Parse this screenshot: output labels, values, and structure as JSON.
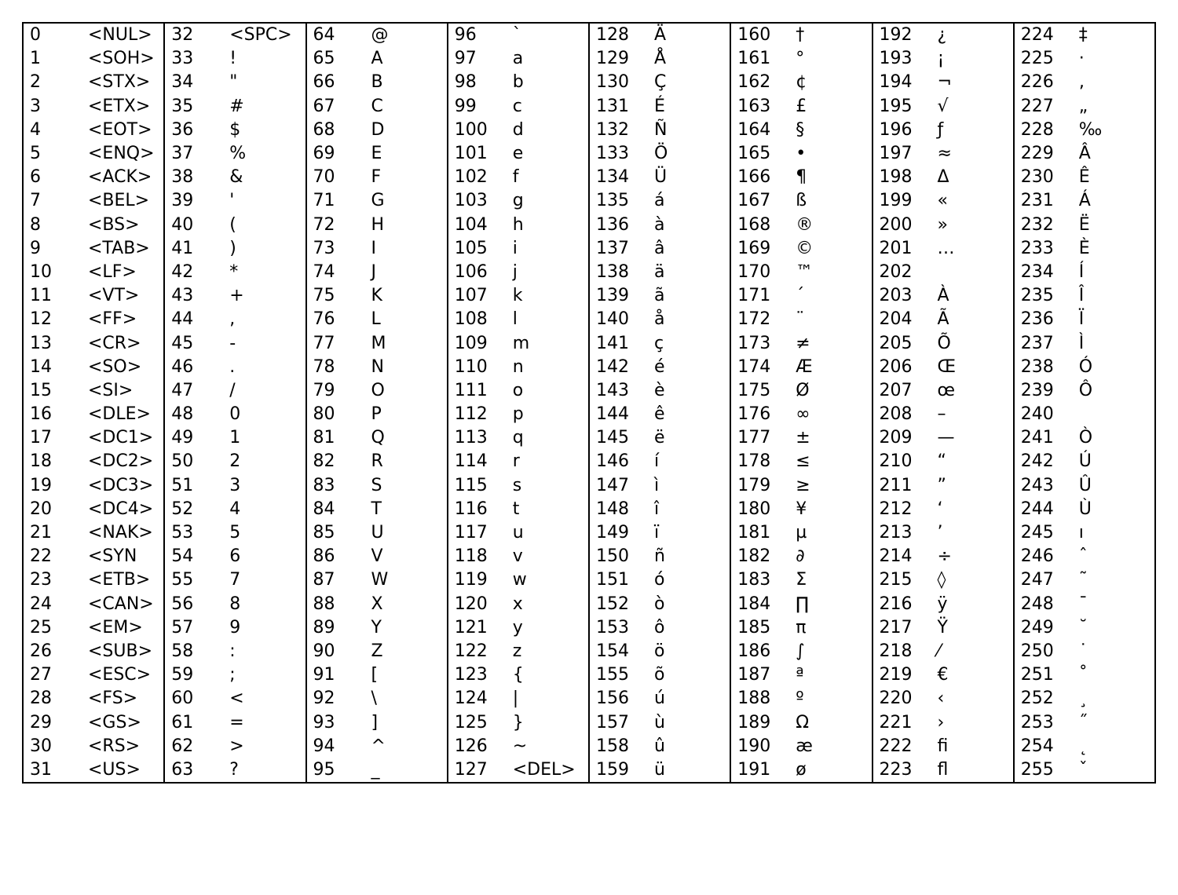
{
  "columns": [
    [
      {
        "code": "0",
        "char": "<NUL>"
      },
      {
        "code": "1",
        "char": "<SOH>"
      },
      {
        "code": "2",
        "char": "<STX>"
      },
      {
        "code": "3",
        "char": "<ETX>"
      },
      {
        "code": "4",
        "char": "<EOT>"
      },
      {
        "code": "5",
        "char": "<ENQ>"
      },
      {
        "code": "6",
        "char": "<ACK>"
      },
      {
        "code": "7",
        "char": "<BEL>"
      },
      {
        "code": "8",
        "char": "<BS>"
      },
      {
        "code": "9",
        "char": "<TAB>"
      },
      {
        "code": "10",
        "char": "<LF>"
      },
      {
        "code": "11",
        "char": "<VT>"
      },
      {
        "code": "12",
        "char": "<FF>"
      },
      {
        "code": "13",
        "char": "<CR>"
      },
      {
        "code": "14",
        "char": "<SO>"
      },
      {
        "code": "15",
        "char": "<SI>"
      },
      {
        "code": "16",
        "char": "<DLE>"
      },
      {
        "code": "17",
        "char": "<DC1>"
      },
      {
        "code": "18",
        "char": "<DC2>"
      },
      {
        "code": "19",
        "char": "<DC3>"
      },
      {
        "code": "20",
        "char": "<DC4>"
      },
      {
        "code": "21",
        "char": "<NAK>"
      },
      {
        "code": "22",
        "char": "<SYN"
      },
      {
        "code": "23",
        "char": "<ETB>"
      },
      {
        "code": "24",
        "char": "<CAN>"
      },
      {
        "code": "25",
        "char": "<EM>"
      },
      {
        "code": "26",
        "char": "<SUB>"
      },
      {
        "code": "27",
        "char": "<ESC>"
      },
      {
        "code": "28",
        "char": "<FS>"
      },
      {
        "code": "29",
        "char": "<GS>"
      },
      {
        "code": "30",
        "char": "<RS>"
      },
      {
        "code": "31",
        "char": "<US>"
      }
    ],
    [
      {
        "code": "32",
        "char": "<SPC>"
      },
      {
        "code": "33",
        "char": "!"
      },
      {
        "code": "34",
        "char": "\""
      },
      {
        "code": "35",
        "char": "#"
      },
      {
        "code": "36",
        "char": "$"
      },
      {
        "code": "37",
        "char": "%"
      },
      {
        "code": "38",
        "char": "&"
      },
      {
        "code": "39",
        "char": "'"
      },
      {
        "code": "40",
        "char": "("
      },
      {
        "code": "41",
        "char": ")"
      },
      {
        "code": "42",
        "char": "*"
      },
      {
        "code": "43",
        "char": "+"
      },
      {
        "code": "44",
        "char": ","
      },
      {
        "code": "45",
        "char": "-"
      },
      {
        "code": "46",
        "char": "."
      },
      {
        "code": "47",
        "char": "/"
      },
      {
        "code": "48",
        "char": "0"
      },
      {
        "code": "49",
        "char": "1"
      },
      {
        "code": "50",
        "char": "2"
      },
      {
        "code": "51",
        "char": "3"
      },
      {
        "code": "52",
        "char": "4"
      },
      {
        "code": "53",
        "char": "5"
      },
      {
        "code": "54",
        "char": "6"
      },
      {
        "code": "55",
        "char": "7"
      },
      {
        "code": "56",
        "char": "8"
      },
      {
        "code": "57",
        "char": "9"
      },
      {
        "code": "58",
        "char": ":"
      },
      {
        "code": "59",
        "char": ";"
      },
      {
        "code": "60",
        "char": "<"
      },
      {
        "code": "61",
        "char": "="
      },
      {
        "code": "62",
        "char": ">"
      },
      {
        "code": "63",
        "char": "?"
      }
    ],
    [
      {
        "code": "64",
        "char": "@"
      },
      {
        "code": "65",
        "char": "A"
      },
      {
        "code": "66",
        "char": "B"
      },
      {
        "code": "67",
        "char": "C"
      },
      {
        "code": "68",
        "char": "D"
      },
      {
        "code": "69",
        "char": "E"
      },
      {
        "code": "70",
        "char": "F"
      },
      {
        "code": "71",
        "char": "G"
      },
      {
        "code": "72",
        "char": "H"
      },
      {
        "code": "73",
        "char": "I"
      },
      {
        "code": "74",
        "char": "J"
      },
      {
        "code": "75",
        "char": "K"
      },
      {
        "code": "76",
        "char": "L"
      },
      {
        "code": "77",
        "char": "M"
      },
      {
        "code": "78",
        "char": "N"
      },
      {
        "code": "79",
        "char": "O"
      },
      {
        "code": "80",
        "char": "P"
      },
      {
        "code": "81",
        "char": "Q"
      },
      {
        "code": "82",
        "char": "R"
      },
      {
        "code": "83",
        "char": "S"
      },
      {
        "code": "84",
        "char": "T"
      },
      {
        "code": "85",
        "char": "U"
      },
      {
        "code": "86",
        "char": "V"
      },
      {
        "code": "87",
        "char": "W"
      },
      {
        "code": "88",
        "char": "X"
      },
      {
        "code": "89",
        "char": "Y"
      },
      {
        "code": "90",
        "char": "Z"
      },
      {
        "code": "91",
        "char": "["
      },
      {
        "code": "92",
        "char": "\\"
      },
      {
        "code": "93",
        "char": "]"
      },
      {
        "code": "94",
        "char": "^"
      },
      {
        "code": "95",
        "char": "_"
      }
    ],
    [
      {
        "code": "96",
        "char": "`"
      },
      {
        "code": "97",
        "char": "a"
      },
      {
        "code": "98",
        "char": "b"
      },
      {
        "code": "99",
        "char": "c"
      },
      {
        "code": "100",
        "char": "d"
      },
      {
        "code": "101",
        "char": "e"
      },
      {
        "code": "102",
        "char": "f"
      },
      {
        "code": "103",
        "char": "g"
      },
      {
        "code": "104",
        "char": "h"
      },
      {
        "code": "105",
        "char": "i"
      },
      {
        "code": "106",
        "char": "j"
      },
      {
        "code": "107",
        "char": "k"
      },
      {
        "code": "108",
        "char": "l"
      },
      {
        "code": "109",
        "char": "m"
      },
      {
        "code": "110",
        "char": "n"
      },
      {
        "code": "111",
        "char": "o"
      },
      {
        "code": "112",
        "char": "p"
      },
      {
        "code": "113",
        "char": "q"
      },
      {
        "code": "114",
        "char": "r"
      },
      {
        "code": "115",
        "char": "s"
      },
      {
        "code": "116",
        "char": "t"
      },
      {
        "code": "117",
        "char": "u"
      },
      {
        "code": "118",
        "char": "v"
      },
      {
        "code": "119",
        "char": "w"
      },
      {
        "code": "120",
        "char": "x"
      },
      {
        "code": "121",
        "char": "y"
      },
      {
        "code": "122",
        "char": "z"
      },
      {
        "code": "123",
        "char": "{"
      },
      {
        "code": "124",
        "char": "|"
      },
      {
        "code": "125",
        "char": "}"
      },
      {
        "code": "126",
        "char": "~"
      },
      {
        "code": "127",
        "char": "<DEL>"
      }
    ],
    [
      {
        "code": "128",
        "char": "Ä"
      },
      {
        "code": "129",
        "char": "Å"
      },
      {
        "code": "130",
        "char": "Ç"
      },
      {
        "code": "131",
        "char": "É"
      },
      {
        "code": "132",
        "char": "Ñ"
      },
      {
        "code": "133",
        "char": "Ö"
      },
      {
        "code": "134",
        "char": "Ü"
      },
      {
        "code": "135",
        "char": "á"
      },
      {
        "code": "136",
        "char": "à"
      },
      {
        "code": "137",
        "char": "â"
      },
      {
        "code": "138",
        "char": "ä"
      },
      {
        "code": "139",
        "char": "ã"
      },
      {
        "code": "140",
        "char": "å"
      },
      {
        "code": "141",
        "char": "ç"
      },
      {
        "code": "142",
        "char": "é"
      },
      {
        "code": "143",
        "char": "è"
      },
      {
        "code": "144",
        "char": "ê"
      },
      {
        "code": "145",
        "char": "ë"
      },
      {
        "code": "146",
        "char": "í"
      },
      {
        "code": "147",
        "char": "ì"
      },
      {
        "code": "148",
        "char": "î"
      },
      {
        "code": "149",
        "char": "ï"
      },
      {
        "code": "150",
        "char": "ñ"
      },
      {
        "code": "151",
        "char": "ó"
      },
      {
        "code": "152",
        "char": "ò"
      },
      {
        "code": "153",
        "char": "ô"
      },
      {
        "code": "154",
        "char": "ö"
      },
      {
        "code": "155",
        "char": "õ"
      },
      {
        "code": "156",
        "char": "ú"
      },
      {
        "code": "157",
        "char": "ù"
      },
      {
        "code": "158",
        "char": "û"
      },
      {
        "code": "159",
        "char": "ü"
      }
    ],
    [
      {
        "code": "160",
        "char": "†"
      },
      {
        "code": "161",
        "char": "°"
      },
      {
        "code": "162",
        "char": "¢"
      },
      {
        "code": "163",
        "char": "£"
      },
      {
        "code": "164",
        "char": "§"
      },
      {
        "code": "165",
        "char": "•"
      },
      {
        "code": "166",
        "char": "¶"
      },
      {
        "code": "167",
        "char": "ß"
      },
      {
        "code": "168",
        "char": "®"
      },
      {
        "code": "169",
        "char": "©"
      },
      {
        "code": "170",
        "char": "™"
      },
      {
        "code": "171",
        "char": "´"
      },
      {
        "code": "172",
        "char": "¨"
      },
      {
        "code": "173",
        "char": "≠"
      },
      {
        "code": "174",
        "char": "Æ"
      },
      {
        "code": "175",
        "char": "Ø"
      },
      {
        "code": "176",
        "char": "∞"
      },
      {
        "code": "177",
        "char": "±"
      },
      {
        "code": "178",
        "char": "≤"
      },
      {
        "code": "179",
        "char": "≥"
      },
      {
        "code": "180",
        "char": "¥"
      },
      {
        "code": "181",
        "char": "µ"
      },
      {
        "code": "182",
        "char": "∂"
      },
      {
        "code": "183",
        "char": "Σ"
      },
      {
        "code": "184",
        "char": "∏"
      },
      {
        "code": "185",
        "char": "π"
      },
      {
        "code": "186",
        "char": "∫"
      },
      {
        "code": "187",
        "char": "ª"
      },
      {
        "code": "188",
        "char": "º"
      },
      {
        "code": "189",
        "char": "Ω"
      },
      {
        "code": "190",
        "char": "æ"
      },
      {
        "code": "191",
        "char": "ø"
      }
    ],
    [
      {
        "code": "192",
        "char": "¿"
      },
      {
        "code": "193",
        "char": "¡"
      },
      {
        "code": "194",
        "char": "¬"
      },
      {
        "code": "195",
        "char": "√"
      },
      {
        "code": "196",
        "char": "ƒ"
      },
      {
        "code": "197",
        "char": "≈"
      },
      {
        "code": "198",
        "char": "Δ"
      },
      {
        "code": "199",
        "char": "«"
      },
      {
        "code": "200",
        "char": "»"
      },
      {
        "code": "201",
        "char": "…"
      },
      {
        "code": "202",
        "char": " "
      },
      {
        "code": "203",
        "char": "À"
      },
      {
        "code": "204",
        "char": "Ã"
      },
      {
        "code": "205",
        "char": "Õ"
      },
      {
        "code": "206",
        "char": "Œ"
      },
      {
        "code": "207",
        "char": "œ"
      },
      {
        "code": "208",
        "char": "–"
      },
      {
        "code": "209",
        "char": "—"
      },
      {
        "code": "210",
        "char": "“"
      },
      {
        "code": "211",
        "char": "”"
      },
      {
        "code": "212",
        "char": "‘"
      },
      {
        "code": "213",
        "char": "’"
      },
      {
        "code": "214",
        "char": "÷"
      },
      {
        "code": "215",
        "char": "◊"
      },
      {
        "code": "216",
        "char": "ÿ"
      },
      {
        "code": "217",
        "char": "Ÿ"
      },
      {
        "code": "218",
        "char": "⁄"
      },
      {
        "code": "219",
        "char": "€"
      },
      {
        "code": "220",
        "char": "‹"
      },
      {
        "code": "221",
        "char": "›"
      },
      {
        "code": "222",
        "char": "ﬁ"
      },
      {
        "code": "223",
        "char": "ﬂ"
      }
    ],
    [
      {
        "code": "224",
        "char": "‡"
      },
      {
        "code": "225",
        "char": "·"
      },
      {
        "code": "226",
        "char": "‚"
      },
      {
        "code": "227",
        "char": "„"
      },
      {
        "code": "228",
        "char": "‰"
      },
      {
        "code": "229",
        "char": "Â"
      },
      {
        "code": "230",
        "char": "Ê"
      },
      {
        "code": "231",
        "char": "Á"
      },
      {
        "code": "232",
        "char": "Ë"
      },
      {
        "code": "233",
        "char": "È"
      },
      {
        "code": "234",
        "char": "Í"
      },
      {
        "code": "235",
        "char": "Î"
      },
      {
        "code": "236",
        "char": "Ï"
      },
      {
        "code": "237",
        "char": "Ì"
      },
      {
        "code": "238",
        "char": "Ó"
      },
      {
        "code": "239",
        "char": "Ô"
      },
      {
        "code": "240",
        "char": ""
      },
      {
        "code": "241",
        "char": "Ò"
      },
      {
        "code": "242",
        "char": "Ú"
      },
      {
        "code": "243",
        "char": "Û"
      },
      {
        "code": "244",
        "char": "Ù"
      },
      {
        "code": "245",
        "char": "ı"
      },
      {
        "code": "246",
        "char": "ˆ"
      },
      {
        "code": "247",
        "char": "˜"
      },
      {
        "code": "248",
        "char": "¯"
      },
      {
        "code": "249",
        "char": "˘"
      },
      {
        "code": "250",
        "char": "˙"
      },
      {
        "code": "251",
        "char": "˚"
      },
      {
        "code": "252",
        "char": "¸"
      },
      {
        "code": "253",
        "char": "˝"
      },
      {
        "code": "254",
        "char": "˛"
      },
      {
        "code": "255",
        "char": "ˇ"
      }
    ]
  ]
}
